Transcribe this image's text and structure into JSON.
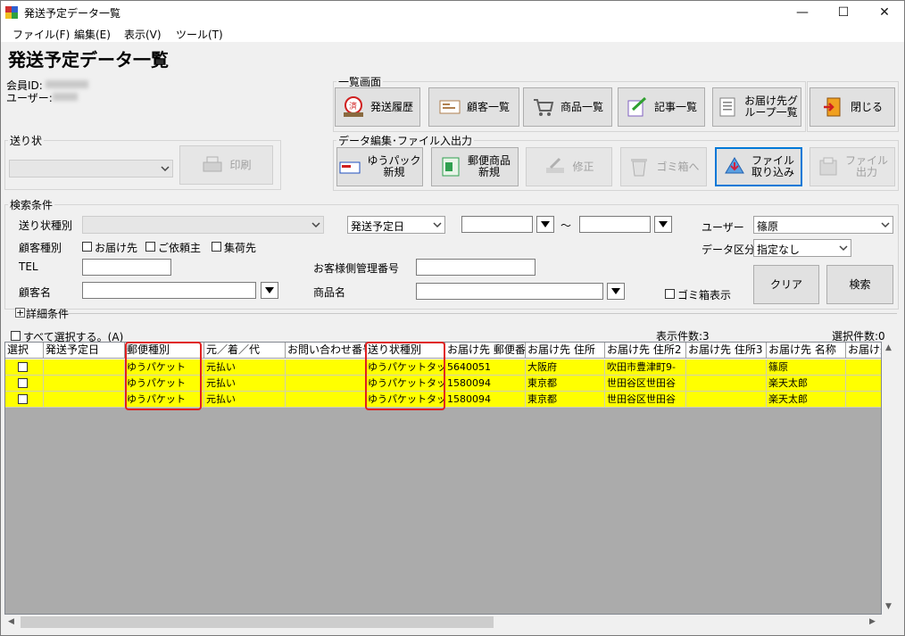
{
  "window": {
    "title": "発送予定データ一覧",
    "minimize": "—",
    "maximize": "☐",
    "close": "✕"
  },
  "menu": [
    "ファイル(F)",
    "編集(E)",
    "表示(V)",
    "ツール(T)"
  ],
  "page_title": "発送予定データ一覧",
  "member_id_label": "会員ID:",
  "user_label": "ユーザー:",
  "list_screen": {
    "label": "一覧画面",
    "buttons": [
      {
        "label": "発送履歴",
        "icon": "history-icon"
      },
      {
        "label": "顧客一覧",
        "icon": "customer-list-icon"
      },
      {
        "label": "商品一覧",
        "icon": "cart-icon"
      },
      {
        "label": "記事一覧",
        "icon": "article-icon"
      },
      {
        "label": "お届け先グ\nループ一覧",
        "icon": "delivery-group-icon"
      }
    ],
    "close_label": "閉じる"
  },
  "invoice": {
    "label": "送り状",
    "print_label": "印刷"
  },
  "data_edit": {
    "label": "データ編集･ファイル入出力",
    "buttons": [
      {
        "label": "ゆうパック\n新規",
        "icon": "yupack-icon",
        "enabled": true
      },
      {
        "label": "郵便商品\n新規",
        "icon": "postal-icon",
        "enabled": true
      },
      {
        "label": "修正",
        "icon": "edit-icon",
        "enabled": false
      },
      {
        "label": "ゴミ箱へ",
        "icon": "trash-icon",
        "enabled": false
      },
      {
        "label": "ファイル\n取り込み",
        "icon": "import-icon",
        "enabled": true
      },
      {
        "label": "ファイル\n出力",
        "icon": "export-icon",
        "enabled": false
      }
    ]
  },
  "search": {
    "label": "検索条件",
    "invoice_type_label": "送り状種別",
    "date_type_value": "発送予定日",
    "tilde": "〜",
    "user_label": "ユーザー",
    "user_value": "篠原",
    "customer_type_label": "顧客種別",
    "customer_types": [
      "お届け先",
      "ご依頼主",
      "集荷先"
    ],
    "data_class_label": "データ区分",
    "data_class_value": "指定なし",
    "tel_label": "TEL",
    "mgmt_no_label": "お客様側管理番号",
    "customer_name_label": "顧客名",
    "product_name_label": "商品名",
    "trash_show_label": "ゴミ箱表示",
    "clear_label": "クリア",
    "search_label": "検索",
    "detail_toggle": "+",
    "detail_label": "詳細条件"
  },
  "list": {
    "select_all_label": "すべて選択する。(A)",
    "display_count": "表示件数:3",
    "selected_count": "選択件数:0",
    "columns": [
      "選択",
      "発送予定日",
      "郵便種別",
      "元／着／代",
      "お問い合わせ番号",
      "送り状種別",
      "お届け先 郵便番号",
      "お届け先 住所",
      "お届け先 住所2",
      "お届け先 住所3",
      "お届け先 名称",
      "お届け先"
    ],
    "rows": [
      [
        "",
        "",
        "ゆうパケット",
        "元払い",
        "",
        "ゆうパケットタックシール",
        "5640051",
        "大阪府",
        "吹田市豊津町9-",
        "",
        "篠原",
        ""
      ],
      [
        "",
        "",
        "ゆうパケット",
        "元払い",
        "",
        "ゆうパケットタックシール",
        "1580094",
        "東京都",
        "世田谷区世田谷",
        "",
        "楽天太郎",
        ""
      ],
      [
        "",
        "",
        "ゆうパケット",
        "元払い",
        "",
        "ゆうパケットタックシール",
        "1580094",
        "東京都",
        "世田谷区世田谷",
        "",
        "楽天太郎",
        ""
      ]
    ]
  },
  "colors": {
    "row_highlight": "#ffff00",
    "annotation": "#e02020",
    "focus": "#0078d7"
  }
}
